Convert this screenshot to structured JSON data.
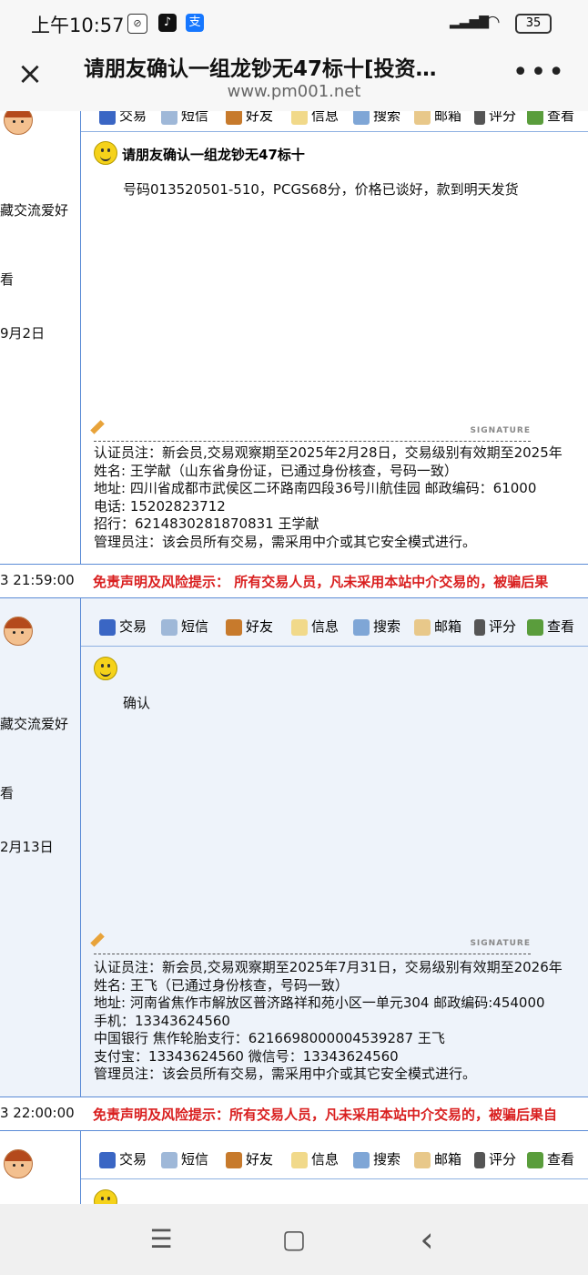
{
  "status_bar": {
    "time": "上午10:57",
    "battery": "35",
    "app_icon_alipay": "支"
  },
  "header": {
    "title": "请朋友确认一组龙钞无47标十[投资…",
    "url": "www.pm001.net",
    "close_icon": "×",
    "more_icon": "•••"
  },
  "toolbar": {
    "trade": "交易",
    "sms": "短信",
    "friend": "好友",
    "info": "信息",
    "search": "搜索",
    "mail": "邮箱",
    "rate": "评分",
    "view": "查看"
  },
  "posts": [
    {
      "left_lines": [
        "藏交流爱好",
        "看",
        "9月2日"
      ],
      "title": "请朋友确认一组龙钞无47标十",
      "body": "号码013520501-510，PCGS68分，价格已谈好，款到明天发货",
      "signature_label": "SIGNATURE",
      "sig_lines": [
        "认证员注：新会员,交易观察期至2025年2月28日，交易级别有效期至2025年",
        "姓名: 王学献（山东省身份证，已通过身份核查，号码一致）",
        "地址: 四川省成都市武侯区二环路南四段36号川航佳园        邮政编码：61000",
        "电话: 15202823712",
        "招行：6214830281870831    王学献",
        "管理员注：该会员所有交易，需采用中介或其它安全模式进行。"
      ],
      "footer_date": "3 21:59:00",
      "footer_disclaimer": "免责声明及风险提示：  所有交易人员，凡未采用本站中介交易的，被骗后果"
    },
    {
      "left_lines": [
        "藏交流爱好",
        "看",
        "2月13日"
      ],
      "title": "",
      "body": "确认",
      "signature_label": "SIGNATURE",
      "sig_lines": [
        "认证员注：新会员,交易观察期至2025年7月31日，交易级别有效期至2026年",
        "姓名: 王飞（已通过身份核查，号码一致）",
        "地址: 河南省焦作市解放区普济路祥和苑小区一单元304    邮政编码:454000",
        "手机：13343624560",
        "中国银行 焦作轮胎支行：6216698000004539287   王飞",
        "支付宝：13343624560 微信号：13343624560",
        "管理员注：该会员所有交易，需采用中介或其它安全模式进行。"
      ],
      "footer_date": "3 22:00:00",
      "footer_disclaimer": "免责声明及风险提示：所有交易人员，凡未采用本站中介交易的，被骗后果自"
    }
  ],
  "nav": {
    "menu_icon": "☰",
    "home_icon": "▢",
    "back_icon": "‹"
  }
}
